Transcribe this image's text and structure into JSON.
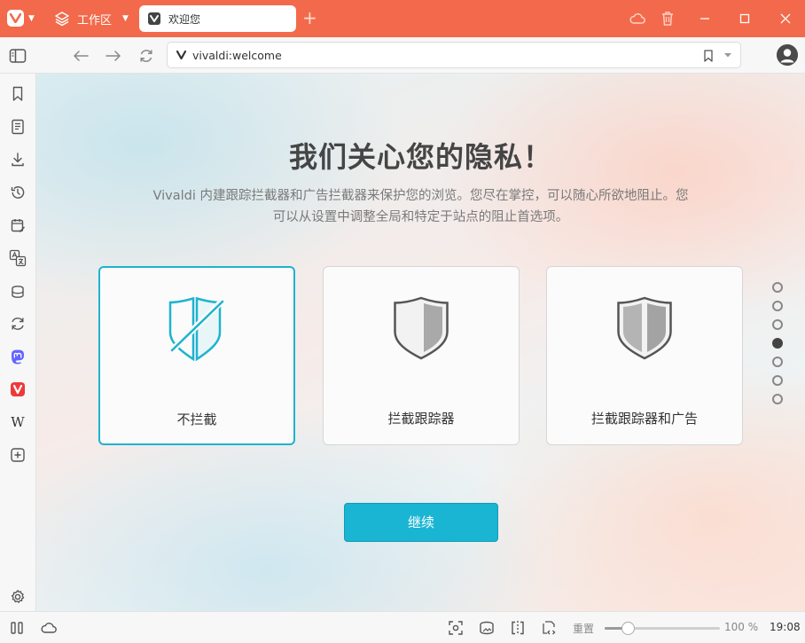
{
  "window": {
    "workspace_label": "工作区",
    "tab_title": "欢迎您",
    "new_tab_symbol": "+"
  },
  "address": {
    "url": "vivaldi:welcome"
  },
  "sidebar": {
    "items": [
      "bookmark-icon",
      "reading-list-icon",
      "downloads-icon",
      "history-icon",
      "calendar-icon",
      "translate-icon",
      "notes-icon",
      "sync-icon",
      "mastodon-icon",
      "vivaldi-social-icon",
      "wikipedia-icon",
      "add-panel-icon"
    ],
    "wikipedia_glyph": "W"
  },
  "main": {
    "heading": "我们关心您的隐私！",
    "description": "Vivaldi 内建跟踪拦截器和广告拦截器来保护您的浏览。您尽在掌控，可以随心所欲地阻止。您可以从设置中调整全局和特定于站点的阻止首选项。",
    "options": [
      {
        "label": "不拦截",
        "selected": true
      },
      {
        "label": "拦截跟踪器",
        "selected": false
      },
      {
        "label": "拦截跟踪器和广告",
        "selected": false
      }
    ],
    "steps_total": 7,
    "active_step": 4,
    "continue_label": "继续",
    "accent_color": "#19b5d3"
  },
  "status": {
    "zoom_label": "重置",
    "zoom_value": "100 %",
    "zoom_fraction": 0.2,
    "time": "19:08"
  },
  "colors": {
    "titlebar": "#f26a4b"
  }
}
